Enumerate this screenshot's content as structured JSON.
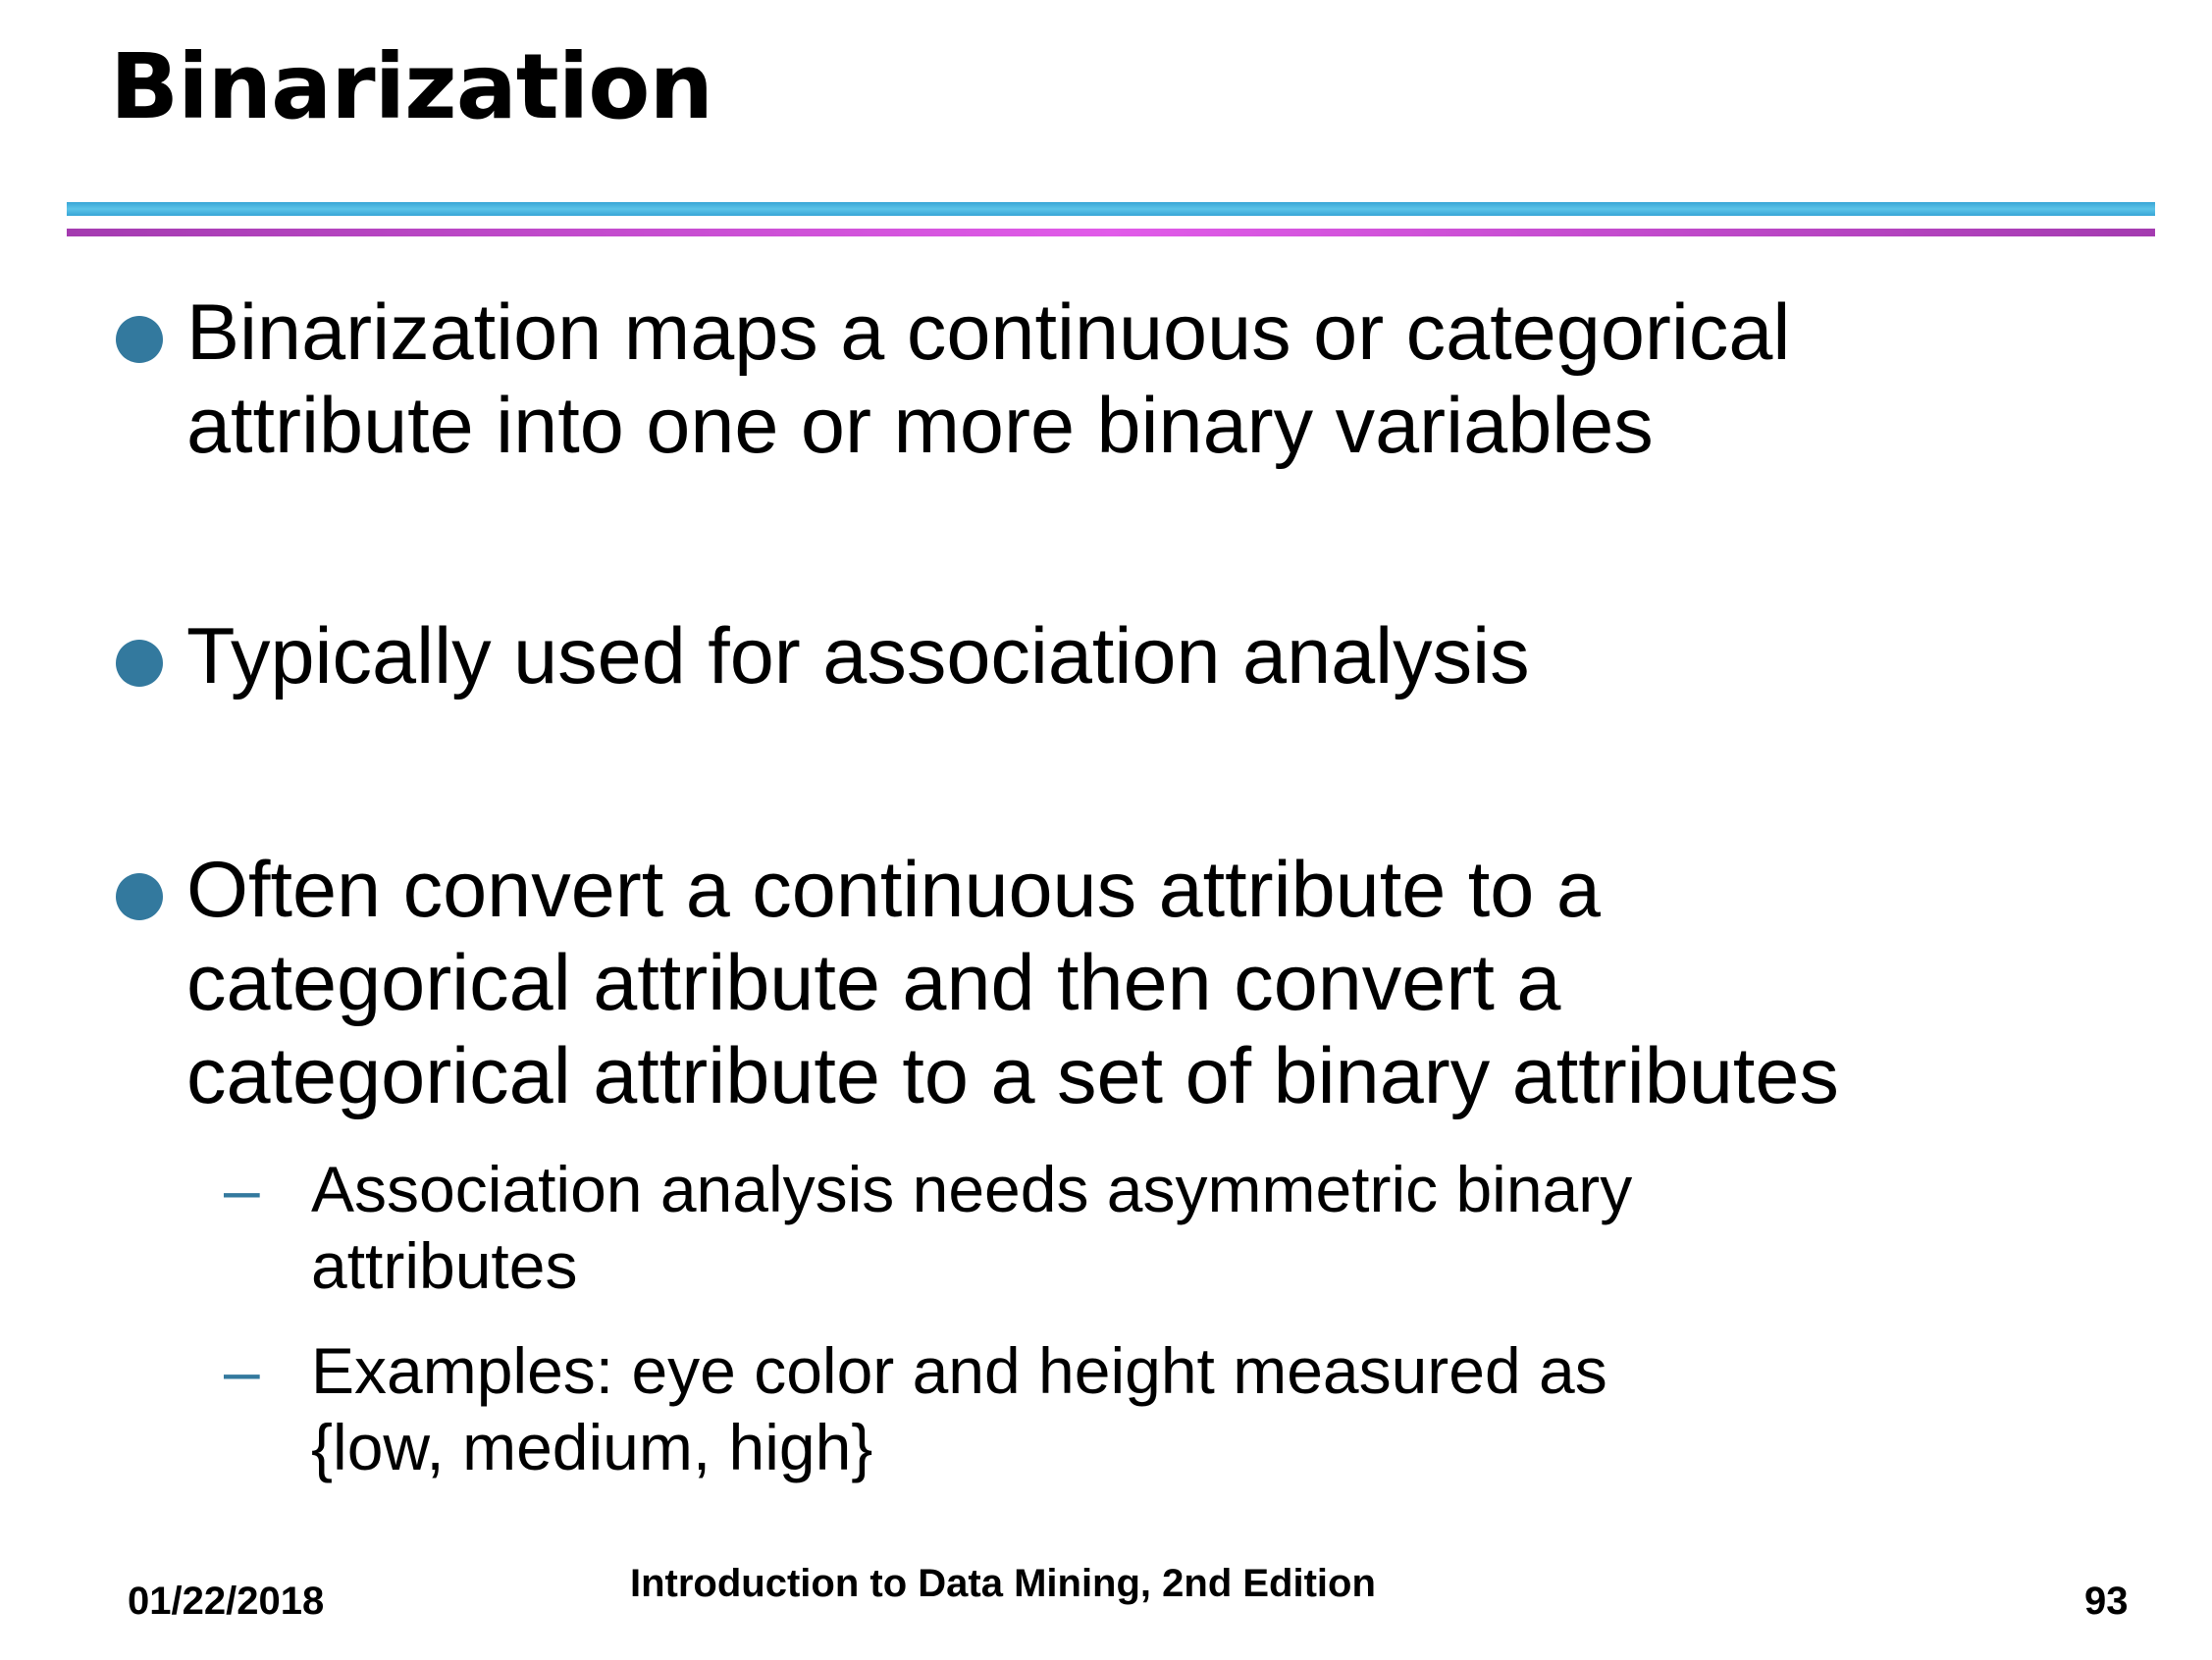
{
  "slide": {
    "title": "Binarization",
    "bullets": [
      {
        "lines": [
          "Binarization maps a continuous or categorical",
          "attribute into one or more binary variables"
        ]
      },
      {
        "lines": [
          "Typically used for association analysis"
        ]
      },
      {
        "lines": [
          "Often convert a continuous attribute to a",
          "categorical attribute and then convert a",
          "categorical attribute to a set of binary attributes"
        ],
        "sub": [
          {
            "dash": "–",
            "lines": [
              "Association analysis needs asymmetric binary",
              "attributes"
            ]
          },
          {
            "dash": "–",
            "lines": [
              "Examples: eye color and height measured as",
              "{low, medium, high}"
            ]
          }
        ]
      }
    ],
    "footer": {
      "date": "01/22/2018",
      "book": "Introduction to Data Mining, 2nd Edition",
      "page": "93"
    }
  },
  "colors": {
    "bullet": "#33799e",
    "rule_blue": "#38a6d6",
    "rule_magenta": "#e15be9"
  }
}
